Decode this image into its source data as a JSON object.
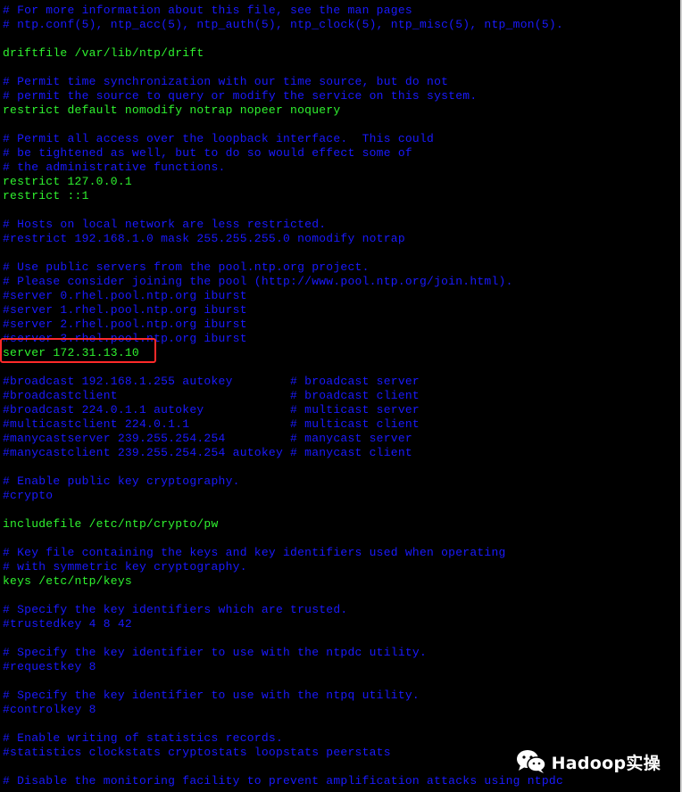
{
  "terminal": {
    "lines": [
      {
        "text": "# For more information about this file, see the man pages",
        "kind": "comment"
      },
      {
        "text": "# ntp.conf(5), ntp_acc(5), ntp_auth(5), ntp_clock(5), ntp_misc(5), ntp_mon(5).",
        "kind": "comment"
      },
      {
        "text": "",
        "kind": "blank"
      },
      {
        "text": "driftfile /var/lib/ntp/drift",
        "kind": "directive"
      },
      {
        "text": "",
        "kind": "blank"
      },
      {
        "text": "# Permit time synchronization with our time source, but do not",
        "kind": "comment"
      },
      {
        "text": "# permit the source to query or modify the service on this system.",
        "kind": "comment"
      },
      {
        "text": "restrict default nomodify notrap nopeer noquery",
        "kind": "directive"
      },
      {
        "text": "",
        "kind": "blank"
      },
      {
        "text": "# Permit all access over the loopback interface.  This could",
        "kind": "comment"
      },
      {
        "text": "# be tightened as well, but to do so would effect some of",
        "kind": "comment"
      },
      {
        "text": "# the administrative functions.",
        "kind": "comment"
      },
      {
        "text": "restrict 127.0.0.1",
        "kind": "directive"
      },
      {
        "text": "restrict ::1",
        "kind": "directive"
      },
      {
        "text": "",
        "kind": "blank"
      },
      {
        "text": "# Hosts on local network are less restricted.",
        "kind": "comment"
      },
      {
        "text": "#restrict 192.168.1.0 mask 255.255.255.0 nomodify notrap",
        "kind": "comment"
      },
      {
        "text": "",
        "kind": "blank"
      },
      {
        "text": "# Use public servers from the pool.ntp.org project.",
        "kind": "comment"
      },
      {
        "text": "# Please consider joining the pool (http://www.pool.ntp.org/join.html).",
        "kind": "comment"
      },
      {
        "text": "#server 0.rhel.pool.ntp.org iburst",
        "kind": "comment"
      },
      {
        "text": "#server 1.rhel.pool.ntp.org iburst",
        "kind": "comment"
      },
      {
        "text": "#server 2.rhel.pool.ntp.org iburst",
        "kind": "comment"
      },
      {
        "text": "#server 3.rhel.pool.ntp.org iburst",
        "kind": "comment"
      },
      {
        "text": "server 172.31.13.10",
        "kind": "directive"
      },
      {
        "text": "",
        "kind": "blank"
      },
      {
        "text": "#broadcast 192.168.1.255 autokey        # broadcast server",
        "kind": "comment"
      },
      {
        "text": "#broadcastclient                        # broadcast client",
        "kind": "comment"
      },
      {
        "text": "#broadcast 224.0.1.1 autokey            # multicast server",
        "kind": "comment"
      },
      {
        "text": "#multicastclient 224.0.1.1              # multicast client",
        "kind": "comment"
      },
      {
        "text": "#manycastserver 239.255.254.254         # manycast server",
        "kind": "comment"
      },
      {
        "text": "#manycastclient 239.255.254.254 autokey # manycast client",
        "kind": "comment"
      },
      {
        "text": "",
        "kind": "blank"
      },
      {
        "text": "# Enable public key cryptography.",
        "kind": "comment"
      },
      {
        "text": "#crypto",
        "kind": "comment"
      },
      {
        "text": "",
        "kind": "blank"
      },
      {
        "text": "includefile /etc/ntp/crypto/pw",
        "kind": "directive"
      },
      {
        "text": "",
        "kind": "blank"
      },
      {
        "text": "# Key file containing the keys and key identifiers used when operating",
        "kind": "comment"
      },
      {
        "text": "# with symmetric key cryptography.",
        "kind": "comment"
      },
      {
        "text": "keys /etc/ntp/keys",
        "kind": "directive"
      },
      {
        "text": "",
        "kind": "blank"
      },
      {
        "text": "# Specify the key identifiers which are trusted.",
        "kind": "comment"
      },
      {
        "text": "#trustedkey 4 8 42",
        "kind": "comment"
      },
      {
        "text": "",
        "kind": "blank"
      },
      {
        "text": "# Specify the key identifier to use with the ntpdc utility.",
        "kind": "comment"
      },
      {
        "text": "#requestkey 8",
        "kind": "comment"
      },
      {
        "text": "",
        "kind": "blank"
      },
      {
        "text": "# Specify the key identifier to use with the ntpq utility.",
        "kind": "comment"
      },
      {
        "text": "#controlkey 8",
        "kind": "comment"
      },
      {
        "text": "",
        "kind": "blank"
      },
      {
        "text": "# Enable writing of statistics records.",
        "kind": "comment"
      },
      {
        "text": "#statistics clockstats cryptostats loopstats peerstats",
        "kind": "comment"
      },
      {
        "text": "",
        "kind": "blank"
      },
      {
        "text": "# Disable the monitoring facility to prevent amplification attacks using ntpdc",
        "kind": "comment"
      }
    ],
    "highlighted_line": "server 172.31.13.10"
  },
  "colors": {
    "background": "#000000",
    "comment": "#1a1aff",
    "directive": "#2ff22f",
    "highlight_border": "#ff2a2a"
  },
  "watermark": {
    "icon": "wechat-icon",
    "text": "Hadoop实操"
  }
}
